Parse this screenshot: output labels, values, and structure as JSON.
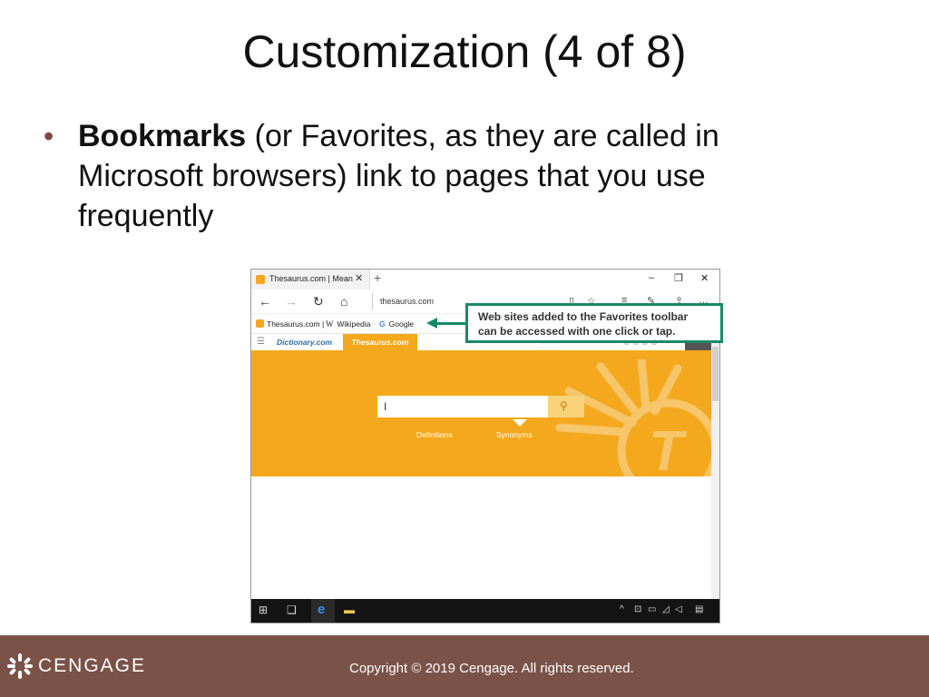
{
  "slide": {
    "title": "Customization (4 of 8)",
    "bullet": {
      "bold": "Bookmarks",
      "text": " (or Favorites, as they are called in Microsoft browsers) link to pages that you use frequently"
    }
  },
  "browser": {
    "tab_title": "Thesaurus.com | Meanir",
    "tab_close": "✕",
    "new_tab": "+",
    "window_controls": {
      "minimize": "–",
      "maximize": "❐",
      "close": "✕"
    },
    "nav": {
      "back": "←",
      "forward": "→",
      "refresh": "↻",
      "home": "⌂"
    },
    "address": "thesaurus.com",
    "favorites": [
      {
        "label": "Thesaurus.com |",
        "icon": "thesaurus-favicon"
      },
      {
        "label": "Wikipedia",
        "icon": "wikipedia-favicon"
      },
      {
        "label": "Google",
        "icon": "google-favicon"
      }
    ],
    "site_tabs": {
      "dictionary": "Dictionary.com",
      "thesaurus": "Thesaurus.com"
    },
    "search": {
      "cursor": "I"
    },
    "hero_links": {
      "definitions": "Definitions",
      "synonyms": "Synonyms"
    },
    "logo_letter": "T"
  },
  "callout": {
    "line1": "Web sites added to the Favorites toolbar",
    "line2": "can be accessed with one click or tap."
  },
  "footer": {
    "brand": "CENGAGE",
    "copyright": "Copyright © 2019 Cengage. All rights reserved."
  },
  "colors": {
    "accent_orange": "#f4a81d",
    "callout_green": "#178a66",
    "footer_brown": "#7b5248"
  }
}
